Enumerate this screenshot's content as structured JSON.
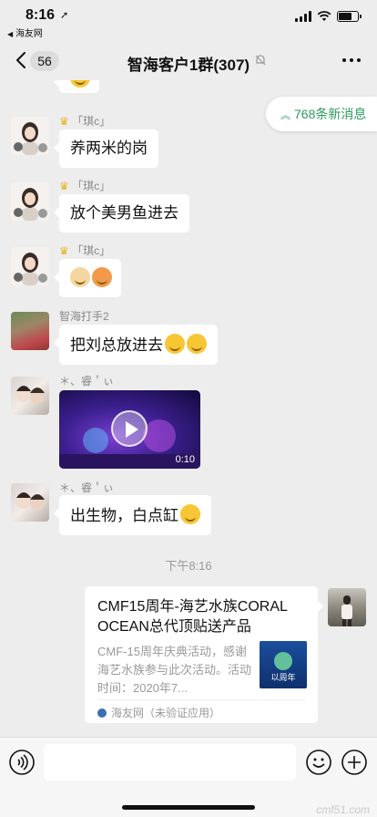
{
  "status_bar": {
    "time": "8:16",
    "back_app": "海友网"
  },
  "nav": {
    "back_count": "56",
    "title": "智海客户1群(307)"
  },
  "new_messages_pill": "768条新消息",
  "messages": [
    {
      "sender": "「琪c」",
      "text": "养两米的岗"
    },
    {
      "sender": "「琪c」",
      "text": "放个美男鱼进去"
    },
    {
      "sender": "「琪c」",
      "text": ""
    },
    {
      "sender": "智海打手2",
      "text": "把刘总放进去"
    },
    {
      "sender": "＊、睿＇ぃ",
      "video_duration": "0:10"
    },
    {
      "sender": "＊、睿＇ぃ",
      "text": "出生物，白点缸"
    }
  ],
  "timestamp": "下午8:16",
  "link_card": {
    "title": "CMF15周年-海艺水族CORAL OCEAN总代顶贴送产品",
    "description": "CMF-15周年庆典活动，感谢海艺水族参与此次活动。活动时间：2020年7...",
    "source": "海友网（未验证应用）"
  },
  "watermark": "cmf51.com"
}
